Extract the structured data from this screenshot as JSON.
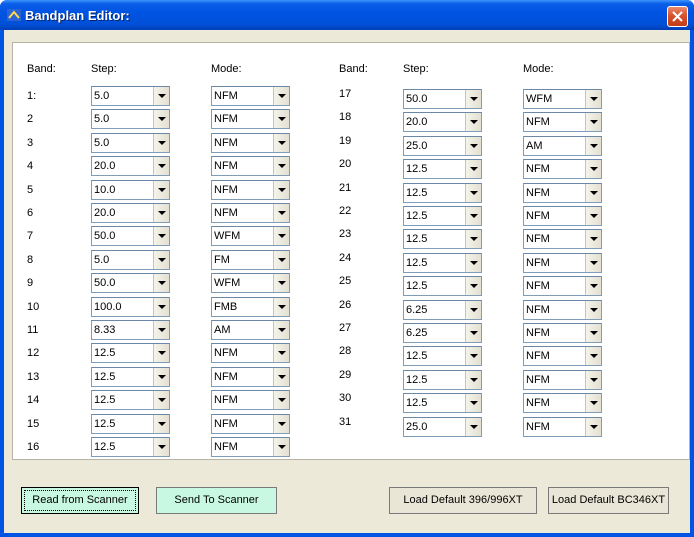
{
  "window": {
    "title": "Bandplan Editor:"
  },
  "headers": {
    "band": "Band:",
    "step": "Step:",
    "mode": "Mode:"
  },
  "left_bands": [
    {
      "label": "1:",
      "step": "5.0",
      "mode": "NFM"
    },
    {
      "label": "2",
      "step": "5.0",
      "mode": "NFM"
    },
    {
      "label": "3",
      "step": "5.0",
      "mode": "NFM"
    },
    {
      "label": "4",
      "step": "20.0",
      "mode": "NFM"
    },
    {
      "label": "5",
      "step": "10.0",
      "mode": "NFM"
    },
    {
      "label": "6",
      "step": "20.0",
      "mode": "NFM"
    },
    {
      "label": "7",
      "step": "50.0",
      "mode": "WFM"
    },
    {
      "label": "8",
      "step": "5.0",
      "mode": "FM"
    },
    {
      "label": "9",
      "step": "50.0",
      "mode": "WFM"
    },
    {
      "label": "10",
      "step": "100.0",
      "mode": "FMB"
    },
    {
      "label": "11",
      "step": "8.33",
      "mode": "AM"
    },
    {
      "label": "12",
      "step": "12.5",
      "mode": "NFM"
    },
    {
      "label": "13",
      "step": "12.5",
      "mode": "NFM"
    },
    {
      "label": "14",
      "step": "12.5",
      "mode": "NFM"
    },
    {
      "label": "15",
      "step": "12.5",
      "mode": "NFM"
    },
    {
      "label": "16",
      "step": "12.5",
      "mode": "NFM"
    }
  ],
  "right_bands": [
    {
      "label": "17",
      "step": "50.0",
      "mode": "WFM"
    },
    {
      "label": "18",
      "step": "20.0",
      "mode": "NFM"
    },
    {
      "label": "19",
      "step": "25.0",
      "mode": "AM"
    },
    {
      "label": "20",
      "step": "12.5",
      "mode": "NFM"
    },
    {
      "label": "21",
      "step": "12.5",
      "mode": "NFM"
    },
    {
      "label": "22",
      "step": "12.5",
      "mode": "NFM"
    },
    {
      "label": "23",
      "step": "12.5",
      "mode": "NFM"
    },
    {
      "label": "24",
      "step": "12.5",
      "mode": "NFM"
    },
    {
      "label": "25",
      "step": "12.5",
      "mode": "NFM"
    },
    {
      "label": "26",
      "step": "6.25",
      "mode": "NFM"
    },
    {
      "label": "27",
      "step": "6.25",
      "mode": "NFM"
    },
    {
      "label": "28",
      "step": "12.5",
      "mode": "NFM"
    },
    {
      "label": "29",
      "step": "12.5",
      "mode": "NFM"
    },
    {
      "label": "30",
      "step": "12.5",
      "mode": "NFM"
    },
    {
      "label": "31",
      "step": "25.0",
      "mode": "NFM"
    }
  ],
  "buttons": {
    "read": "Read from Scanner",
    "send": "Send To Scanner",
    "load396": "Load Default 396/996XT",
    "load346": "Load Default BC346XT"
  },
  "colors": {
    "titlebar": "#0054e3",
    "mint_button": "#c8f8e2",
    "dialog_bg": "#ece9d8",
    "close_button": "#d8522d"
  }
}
